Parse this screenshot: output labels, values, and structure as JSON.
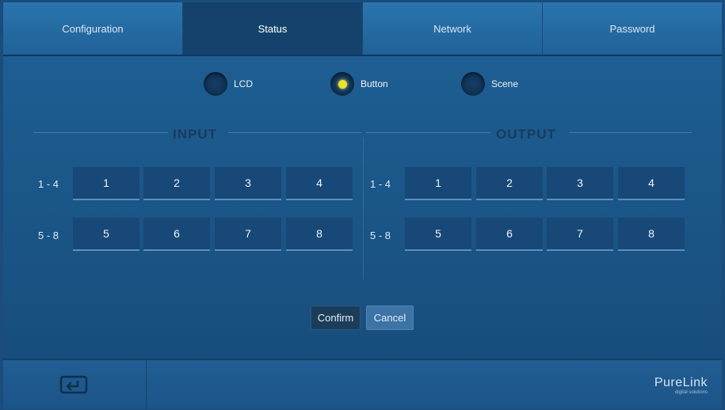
{
  "tabs": [
    {
      "label": "Configuration",
      "active": false
    },
    {
      "label": "Status",
      "active": true
    },
    {
      "label": "Network",
      "active": false
    },
    {
      "label": "Password",
      "active": false
    }
  ],
  "modes": {
    "lcd": {
      "label": "LCD",
      "selected": false
    },
    "button": {
      "label": "Button",
      "selected": true
    },
    "scene": {
      "label": "Scene",
      "selected": false
    }
  },
  "input": {
    "title": "INPUT",
    "row1_label": "1 - 4",
    "row2_label": "5 - 8",
    "buttons": [
      "1",
      "2",
      "3",
      "4",
      "5",
      "6",
      "7",
      "8"
    ]
  },
  "output": {
    "title": "OUTPUT",
    "row1_label": "1 - 4",
    "row2_label": "5 - 8",
    "buttons": [
      "1",
      "2",
      "3",
      "4",
      "5",
      "6",
      "7",
      "8"
    ]
  },
  "actions": {
    "confirm": "Confirm",
    "cancel": "Cancel"
  },
  "footer": {
    "home_icon": "return-icon",
    "logo_main": "PureLink",
    "logo_sub": "digital solutions"
  },
  "colors": {
    "radio_selected": "#e9e230",
    "active_tab": "#15426c",
    "button_bg": "#184878"
  }
}
